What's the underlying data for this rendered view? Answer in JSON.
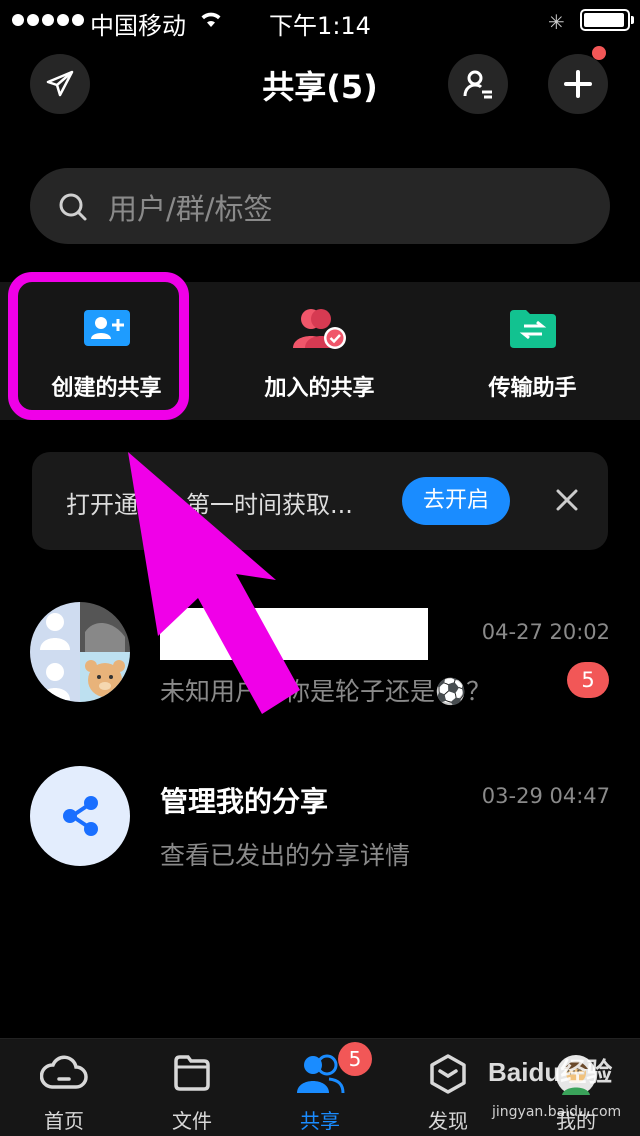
{
  "status_bar": {
    "carrier": "中国移动",
    "time": "下午1:14"
  },
  "header": {
    "title": "共享(5)"
  },
  "search": {
    "placeholder": "用户/群/标签"
  },
  "quick_actions": [
    {
      "label": "创建的共享",
      "icon": "add-user-card-icon",
      "color": "#1e9cff"
    },
    {
      "label": "加入的共享",
      "icon": "joined-users-icon",
      "color": "#f0566a"
    },
    {
      "label": "传输助手",
      "icon": "transfer-folder-icon",
      "color": "#12c290"
    }
  ],
  "banner": {
    "text": "打开通知，第一时间获取...",
    "button": "去开启"
  },
  "conversations": [
    {
      "name": "",
      "time": "04-27 20:02",
      "message": "未知用户：你是轮子还是⚽？",
      "badge": "5"
    },
    {
      "name": "管理我的分享",
      "time": "03-29 04:47",
      "message": "查看已发出的分享详情"
    }
  ],
  "tabs": [
    {
      "label": "首页",
      "icon": "cloud-home-icon"
    },
    {
      "label": "文件",
      "icon": "folder-icon"
    },
    {
      "label": "共享",
      "icon": "share-people-icon",
      "active": true,
      "badge": "5"
    },
    {
      "label": "发现",
      "icon": "discover-box-icon"
    },
    {
      "label": "我的",
      "icon": "profile-icon"
    }
  ],
  "watermark": {
    "brand": "Baidu经验",
    "url": "jingyan.baidu.com"
  },
  "colors": {
    "accent": "#1a8cff",
    "highlight": "#f000e8",
    "badge": "#f25757"
  }
}
